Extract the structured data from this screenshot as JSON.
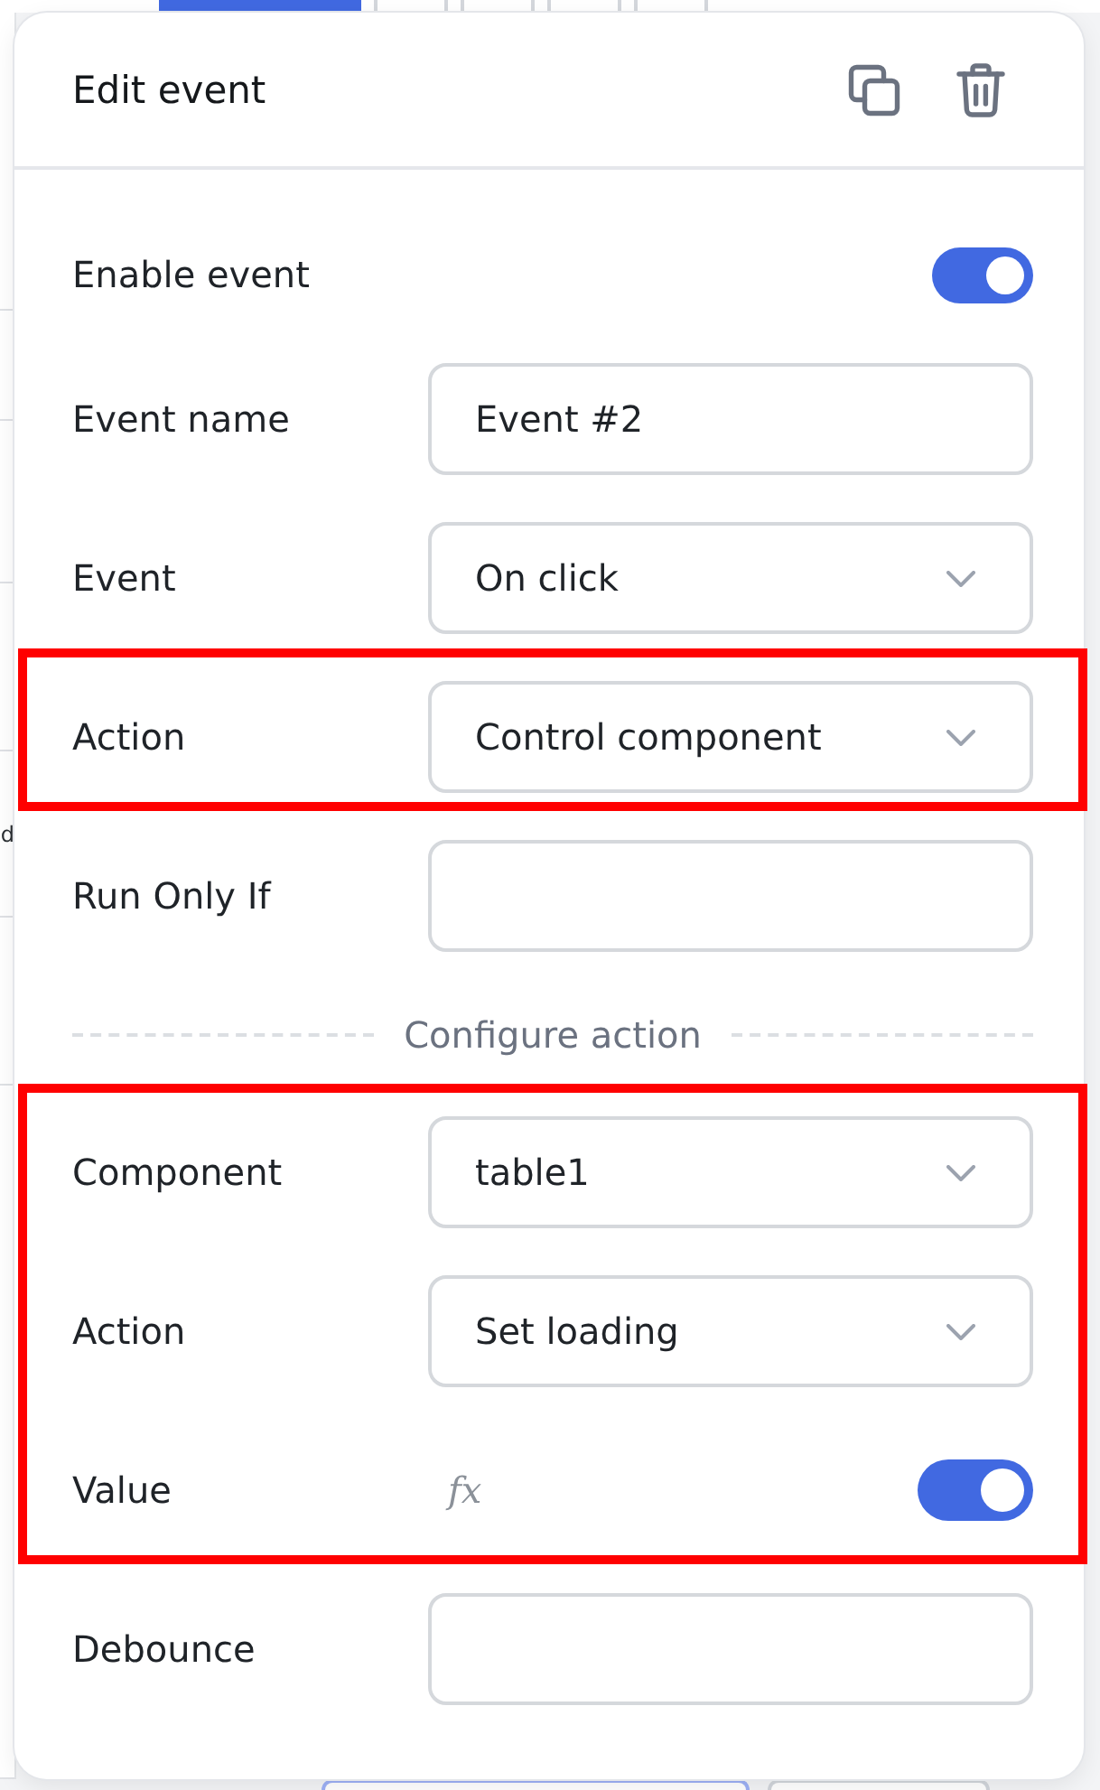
{
  "panel": {
    "title": "Edit event"
  },
  "fields": [
    {
      "kind": "toggle",
      "label": "Enable event",
      "on": true,
      "highlighted": false
    },
    {
      "kind": "input",
      "label": "Event name",
      "value": "Event #2",
      "highlighted": false
    },
    {
      "kind": "select",
      "label": "Event",
      "value": "On click",
      "highlighted": false
    },
    {
      "kind": "select",
      "label": "Action",
      "value": "Control component",
      "highlighted": true
    },
    {
      "kind": "input",
      "label": "Run Only If",
      "highlighted": false
    }
  ],
  "section_divider": {
    "label": "Configure action"
  },
  "action_fields": [
    {
      "kind": "select",
      "label": "Component",
      "value": "table1",
      "highlighted": true
    },
    {
      "kind": "select",
      "label": "Action",
      "value": "Set loading",
      "highlighted": true
    },
    {
      "kind": "formula_toggle",
      "label": "Value",
      "formula": "fx",
      "on": true,
      "highlighted": true
    },
    {
      "kind": "input",
      "label": "Debounce",
      "highlighted": false
    }
  ],
  "background": {
    "cut_text": "d"
  }
}
